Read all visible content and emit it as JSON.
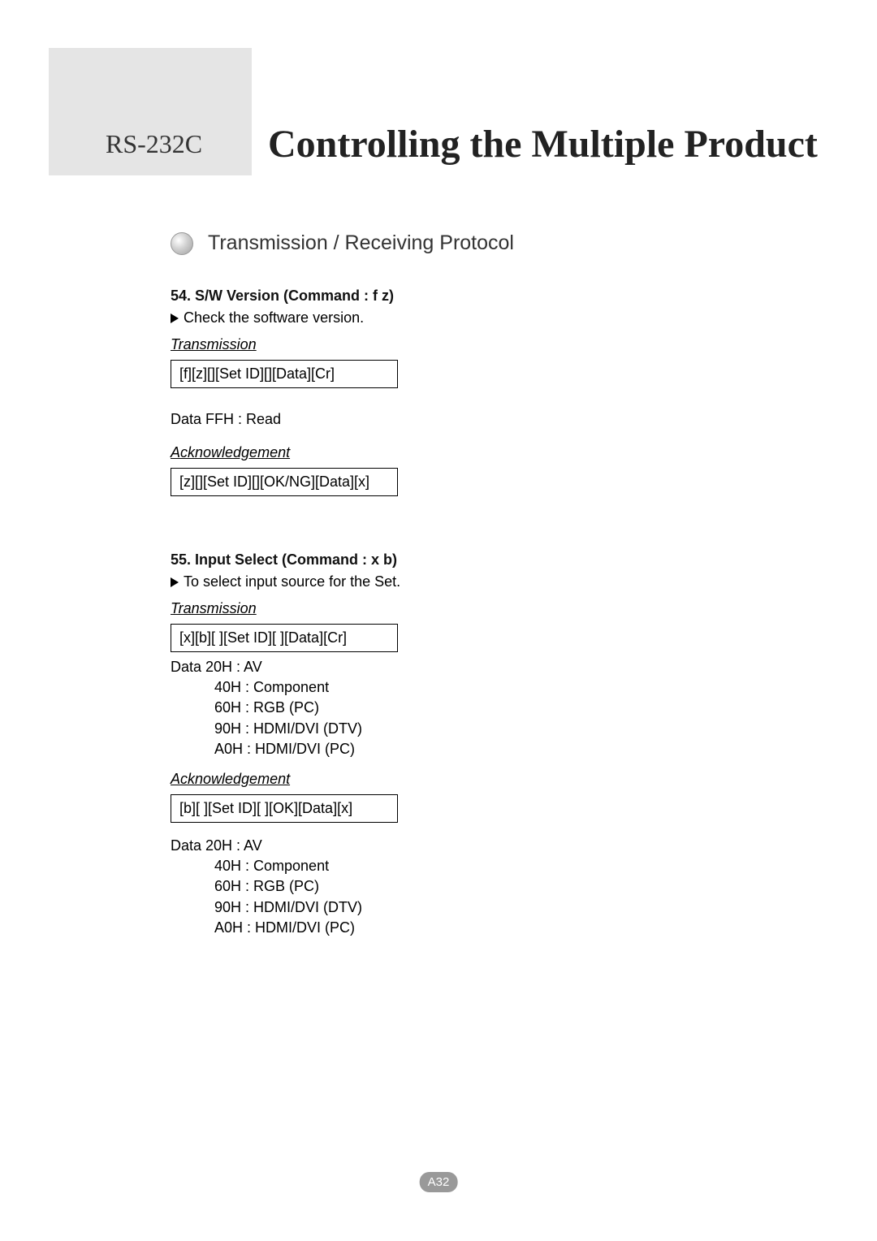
{
  "header": {
    "left": "RS-232C",
    "right": "Controlling the Multiple Product"
  },
  "section_title": "Transmission / Receiving Protocol",
  "labels": {
    "transmission": "Transmission",
    "acknowledgement": "Acknowledgement"
  },
  "cmd54": {
    "heading": "54. S/W Version (Command : f z)",
    "desc": "Check the software version.",
    "tx_box": "[f][z][][Set ID][][Data][Cr]",
    "data_line": "Data FFH : Read",
    "ack_box": "[z][][Set ID][][OK/NG][Data][x]"
  },
  "cmd55": {
    "heading": "55. Input Select (Command : x b)",
    "desc": "To select input source for the Set.",
    "tx_box": "[x][b][ ][Set ID][ ][Data][Cr]",
    "data1_l1": "Data  20H : AV",
    "data1_l2": "40H : Component",
    "data1_l3": "60H : RGB (PC)",
    "data1_l4": "90H : HDMI/DVI (DTV)",
    "data1_l5": "A0H : HDMI/DVI (PC)",
    "ack_box": "[b][ ][Set ID][ ][OK][Data][x]",
    "data2_l1": "Data  20H : AV",
    "data2_l2": "40H : Component",
    "data2_l3": " 60H : RGB (PC)",
    "data2_l4": "90H : HDMI/DVI (DTV)",
    "data2_l5": "A0H : HDMI/DVI (PC)"
  },
  "page_num": "A32"
}
